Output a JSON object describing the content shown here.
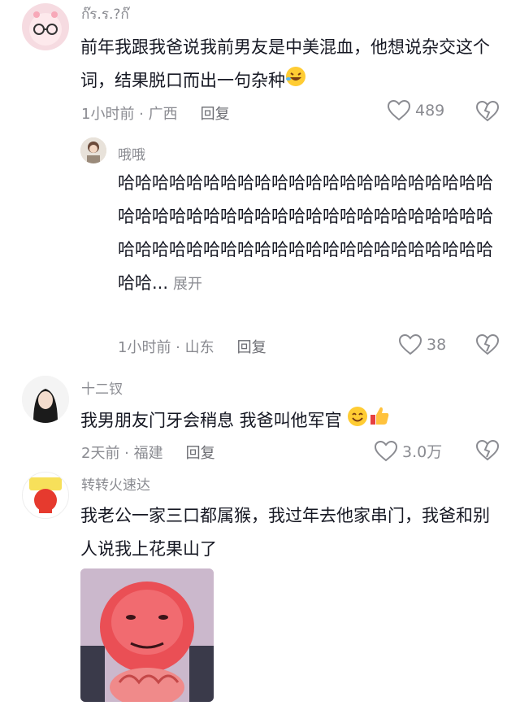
{
  "comments": [
    {
      "username": "ก๊ร.ร.?ก๊",
      "text": "前年我跟我爸说我前男友是中美混血，他想说杂交这个词，结果脱口而出一句杂种",
      "emoji": "rolling-laughing-emoji",
      "time_location": "1小时前 · 广西",
      "reply_label": "回复",
      "likes": "489"
    },
    {
      "username": "哦哦",
      "text": "哈哈哈哈哈哈哈哈哈哈哈哈哈哈哈哈哈哈哈哈哈哈哈哈哈哈哈哈哈哈哈哈哈哈哈哈哈哈哈哈哈哈哈哈哈哈哈哈哈哈哈哈哈哈哈哈哈哈哈哈哈哈哈哈哈哈哈哈...",
      "expand_label": "展开",
      "time_location": "1小时前 · 山东",
      "reply_label": "回复",
      "likes": "38"
    },
    {
      "username": "十二钗",
      "text": "我男朋友门牙会稍息 我爸叫他军官",
      "emoji": "smile-emoji thumbs-up-emoji",
      "time_location": "2天前 · 福建",
      "reply_label": "回复",
      "likes": "3.0万"
    },
    {
      "username": "转转火速达",
      "text": "我老公一家三口都属猴，我过年去他家串门，我爸和别人说我上花果山了"
    }
  ],
  "colors": {
    "text": "#161823",
    "secondary": "#8a8b91"
  }
}
